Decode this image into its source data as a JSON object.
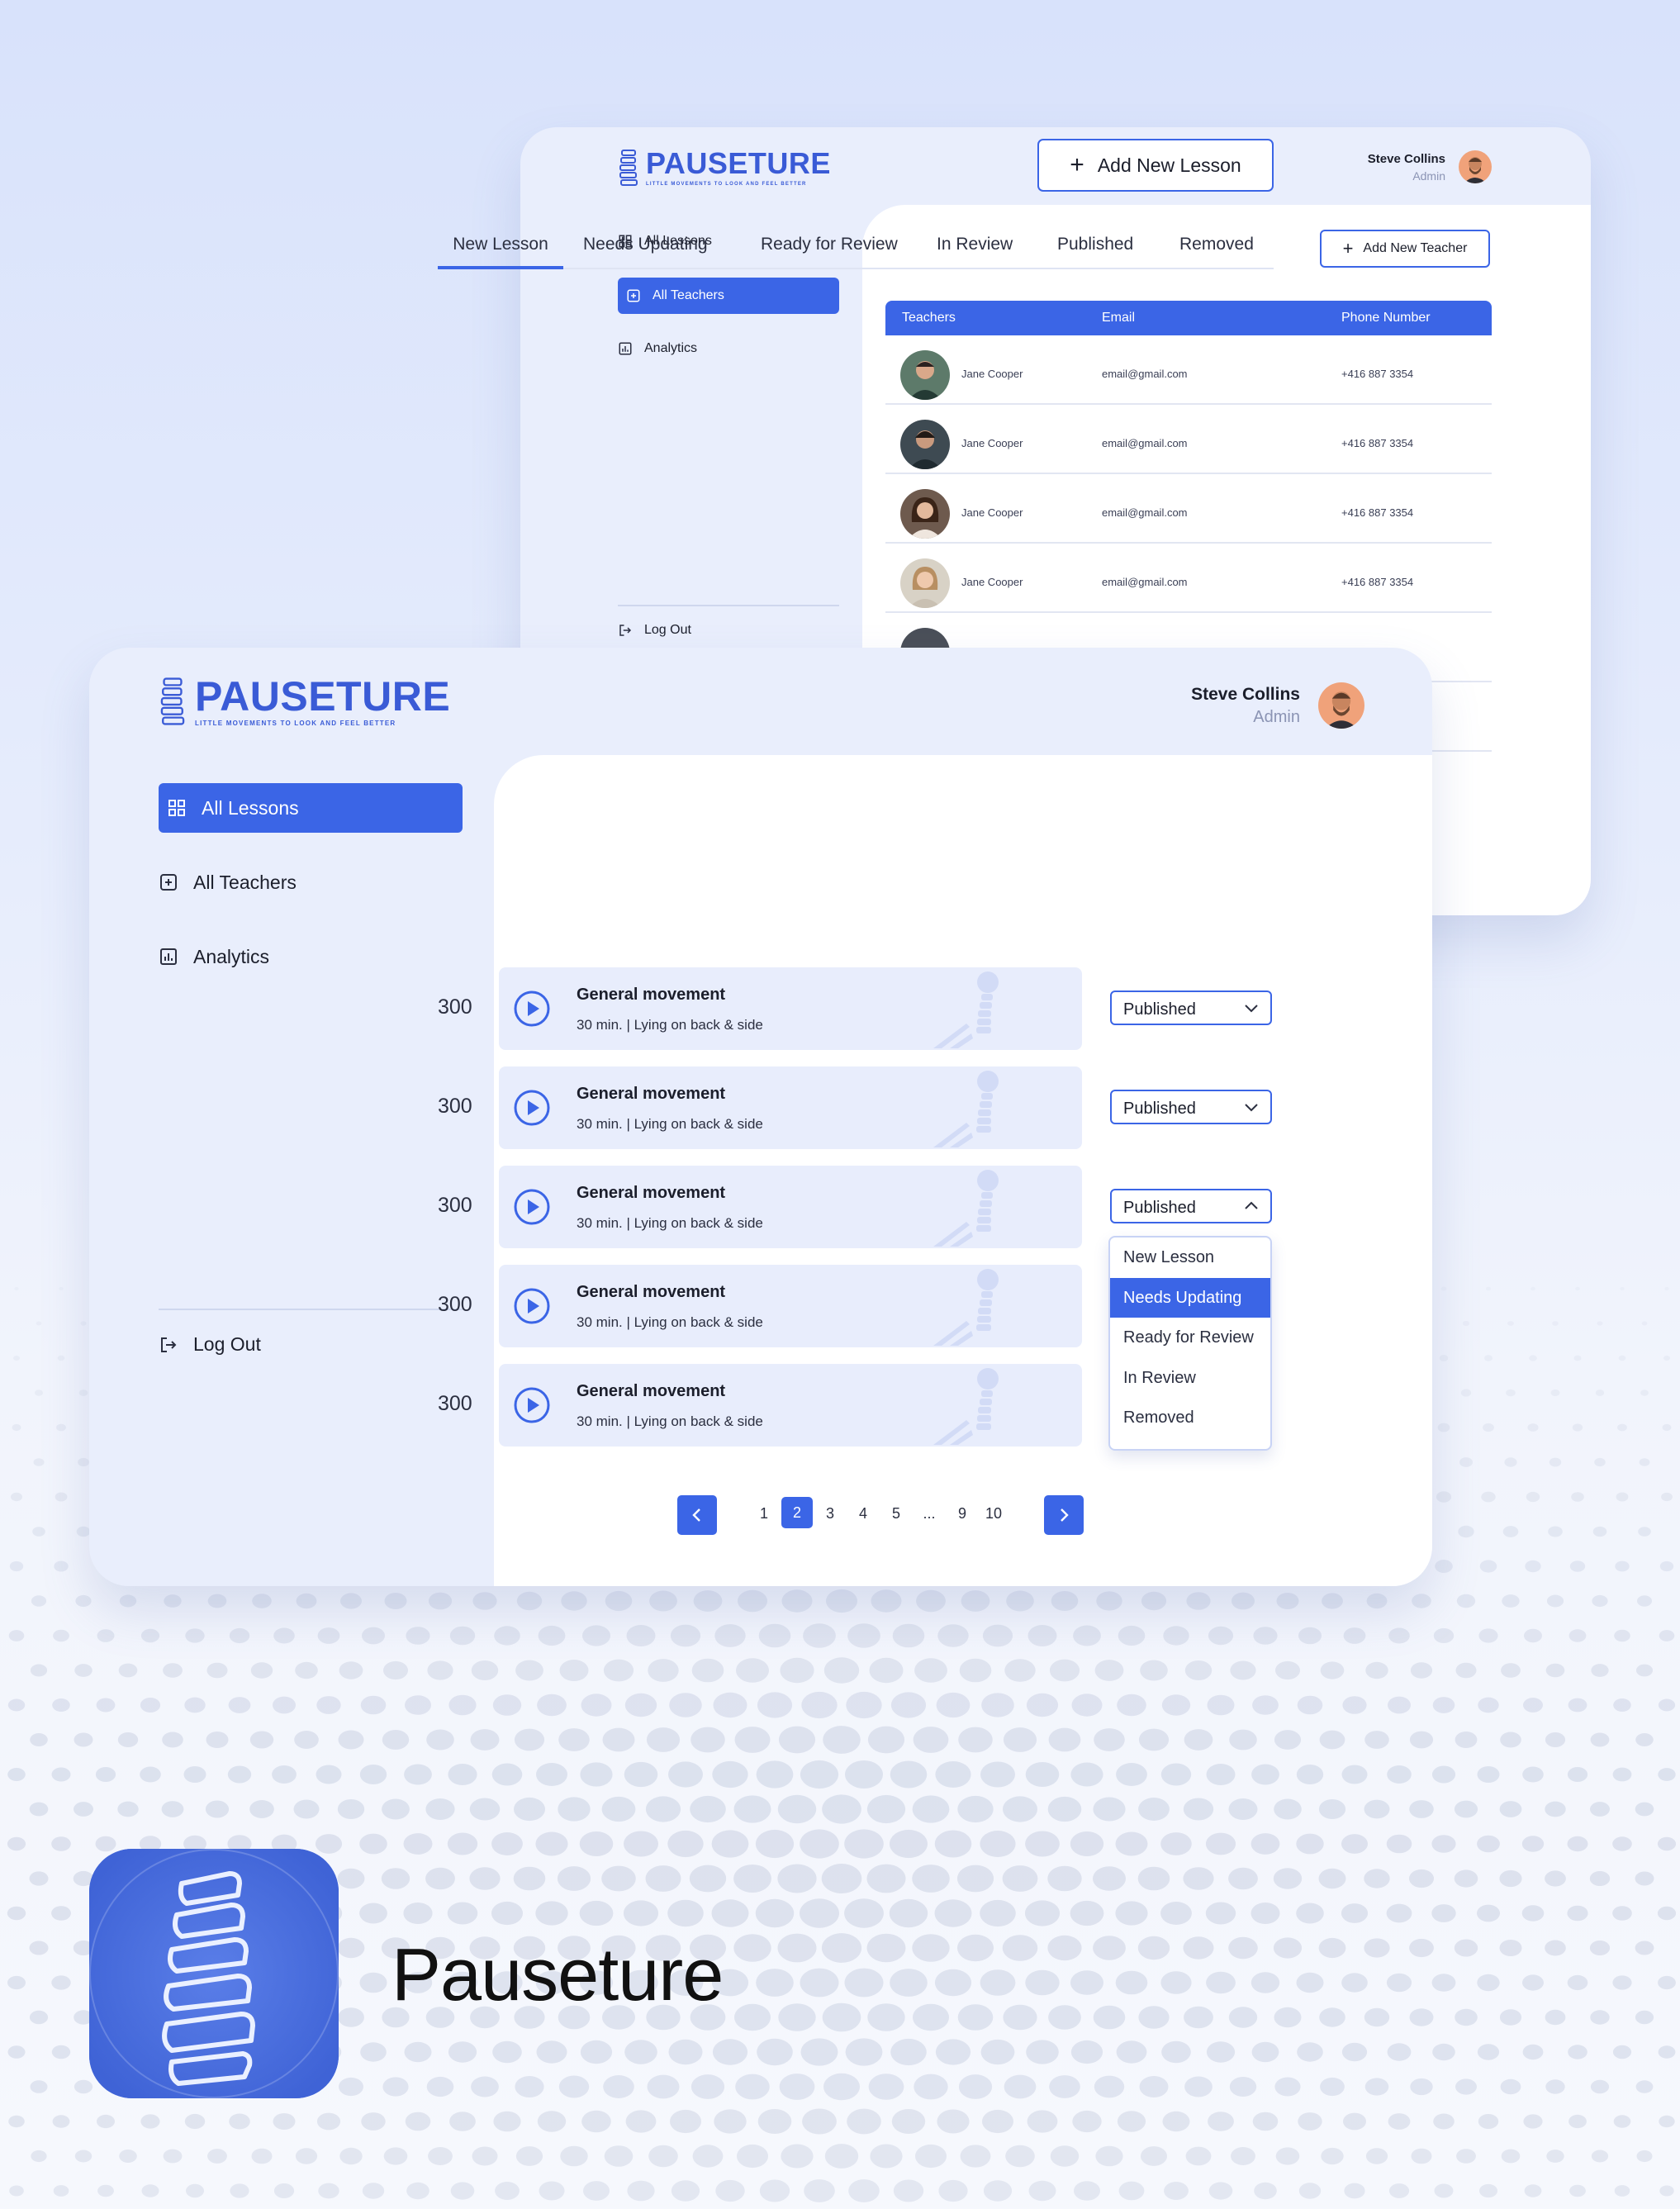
{
  "brand": {
    "name": "PAUSETURE",
    "tagline": "LITTLE MOVEMENTS TO LOOK AND FEEL BETTER",
    "app_name": "Pauseture",
    "accent_color": "#3b65e6"
  },
  "user": {
    "name": "Steve Collins",
    "role": "Admin"
  },
  "back_window": {
    "nav": [
      {
        "label": "All Lessons",
        "icon": "grid-icon",
        "active": false
      },
      {
        "label": "All Teachers",
        "icon": "plus-square-icon",
        "active": true
      },
      {
        "label": "Analytics",
        "icon": "chart-icon",
        "active": false
      }
    ],
    "logout_label": "Log Out",
    "add_button_label": "Add New Teacher",
    "table": {
      "columns": [
        "Teachers",
        "Email",
        "Phone Number"
      ],
      "rows": [
        {
          "name": "Jane Cooper",
          "email": "email@gmail.com",
          "phone": "+416 887 3354"
        },
        {
          "name": "Jane Cooper",
          "email": "email@gmail.com",
          "phone": "+416 887 3354"
        },
        {
          "name": "Jane Cooper",
          "email": "email@gmail.com",
          "phone": "+416 887 3354"
        },
        {
          "name": "Jane Cooper",
          "email": "email@gmail.com",
          "phone": "+416 887 3354"
        }
      ]
    }
  },
  "front_window": {
    "nav": [
      {
        "label": "All Lessons",
        "icon": "grid-icon",
        "active": true
      },
      {
        "label": "All Teachers",
        "icon": "plus-square-icon",
        "active": false
      },
      {
        "label": "Analytics",
        "icon": "chart-icon",
        "active": false
      }
    ],
    "logout_label": "Log Out",
    "add_button_label": "Add New Lesson",
    "tabs": [
      {
        "label": "New Lesson",
        "active": true
      },
      {
        "label": "Needs Updating",
        "active": false
      },
      {
        "label": "Ready for Review",
        "active": false
      },
      {
        "label": "In Review",
        "active": false
      },
      {
        "label": "Published",
        "active": false
      },
      {
        "label": "Removed",
        "active": false
      }
    ],
    "lessons": [
      {
        "number": "300",
        "title": "General movement",
        "subtitle": "30 min. | Lying on back & side",
        "status": "Published",
        "open": false
      },
      {
        "number": "300",
        "title": "General movement",
        "subtitle": "30 min. | Lying on back & side",
        "status": "Published",
        "open": false
      },
      {
        "number": "300",
        "title": "General movement",
        "subtitle": "30 min. | Lying on back & side",
        "status": "Published",
        "open": true
      },
      {
        "number": "300",
        "title": "General movement",
        "subtitle": "30 min. | Lying on back & side",
        "status": "",
        "open": false
      },
      {
        "number": "300",
        "title": "General movement",
        "subtitle": "30 min. | Lying on back & side",
        "status": "",
        "open": false
      }
    ],
    "status_dropdown": {
      "options": [
        "New Lesson",
        "Needs Updating",
        "Ready for Review",
        "In Review",
        "Removed"
      ],
      "highlighted": "Needs Updating"
    },
    "pagination": {
      "pages": [
        "1",
        "2",
        "3",
        "4",
        "5",
        "...",
        "9",
        "10"
      ],
      "current": "2"
    }
  }
}
